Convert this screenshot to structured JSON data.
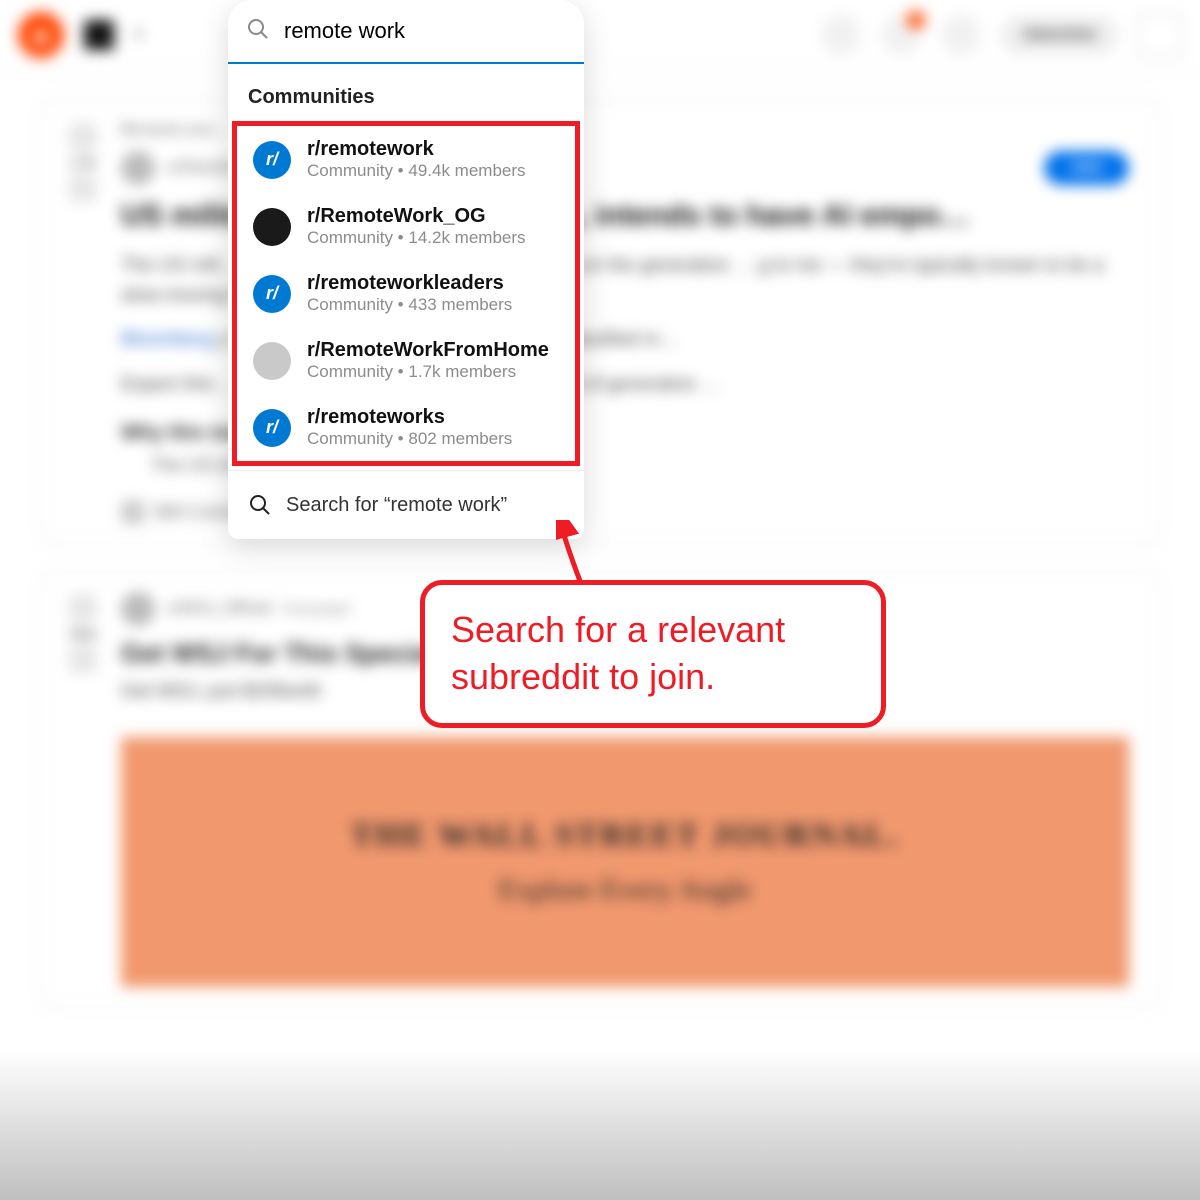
{
  "header": {
    "notification_count": "0",
    "advertise_label": "Advertise"
  },
  "search": {
    "query": "remote work",
    "section_header": "Communities",
    "search_for_label": "Search for “remote work”",
    "results": [
      {
        "name": "r/remotework",
        "meta": "Community • 49.4k members",
        "avatar_bg": "#0079d3",
        "avatar_text": "r/"
      },
      {
        "name": "r/RemoteWork_OG",
        "meta": "Community • 14.2k members",
        "avatar_bg": "#1a1a1a",
        "avatar_text": ""
      },
      {
        "name": "r/remoteworkleaders",
        "meta": "Community • 433 members",
        "avatar_bg": "#0079d3",
        "avatar_text": "r/"
      },
      {
        "name": "r/RemoteWorkFromHome",
        "meta": "Community • 1.7k members",
        "avatar_bg": "#c9c9c9",
        "avatar_text": ""
      },
      {
        "name": "r/remoteworks",
        "meta": "Community • 802 members",
        "avatar_bg": "#0079d3",
        "avatar_text": "r/"
      }
    ]
  },
  "annotation": {
    "text": "Search for a relevant subreddit to join."
  },
  "feed": {
    "post1": {
      "vote": "1.7k",
      "because": "Because you…",
      "author": "u/OkamM…",
      "title": "US militar…                          d on classified data, intends to have AI empo…",
      "body1a": "The US mili…",
      "body1b": ", but the speed at which they've jumped on the generative … g to me — they're typically known to be a slow-moving bet … ew tech.",
      "link": "Bloomberg",
      "body2": " y trialing 5 separate LLMs, all trained on classified m…",
      "body3": "Expect this … es around the world make into the world of generative …",
      "subhead": "Why this matters",
      "bullet": "The US military is traditionally …",
      "comments": "300 Comments",
      "award": "Award",
      "join": "Join"
    },
    "post2": {
      "author": "u/WSJ_Official",
      "promoted": "Promoted",
      "title": "Get WSJ For This Special Price – Just $2/Month. Act Now.",
      "sub": "Get WSJ, just $2/Month",
      "vote": "Vote",
      "banner_title": "THE WALL STREET JOURNAL.",
      "banner_sub": "Explore Every Angle"
    }
  }
}
